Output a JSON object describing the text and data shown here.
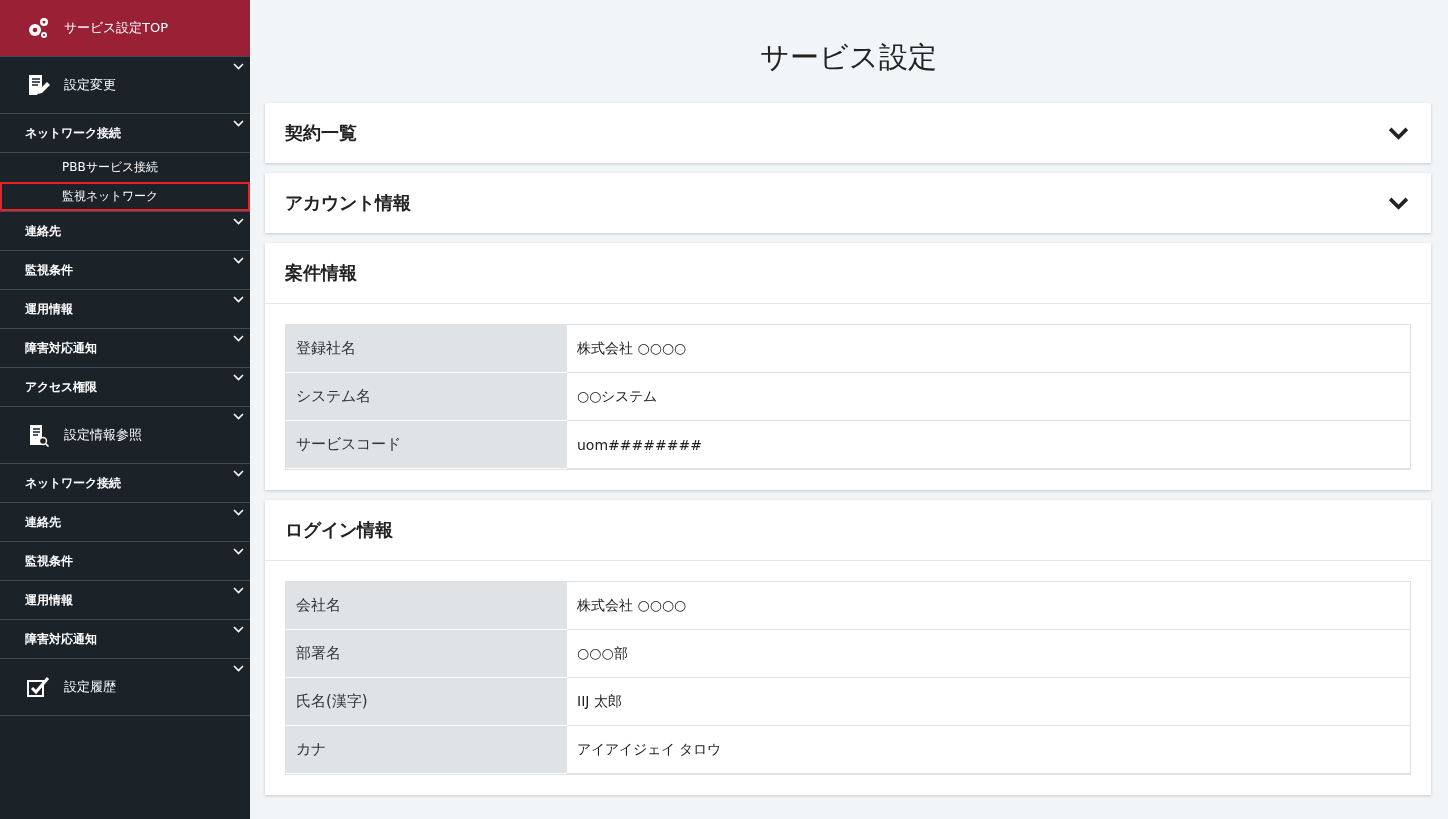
{
  "sidebar": {
    "items": [
      {
        "kind": "top",
        "label": "サービス設定TOP",
        "selected": true
      },
      {
        "kind": "group",
        "label": "設定変更"
      },
      {
        "kind": "section",
        "label": "ネットワーク接続"
      },
      {
        "kind": "sub",
        "label": "PBBサービス接続",
        "selected": false
      },
      {
        "kind": "sub",
        "label": "監視ネットワーク",
        "selected": true
      },
      {
        "kind": "section",
        "label": "連絡先"
      },
      {
        "kind": "section",
        "label": "監視条件"
      },
      {
        "kind": "section",
        "label": "運用情報"
      },
      {
        "kind": "section",
        "label": "障害対応通知"
      },
      {
        "kind": "section",
        "label": "アクセス権限"
      },
      {
        "kind": "group",
        "label": "設定情報参照"
      },
      {
        "kind": "section",
        "label": "ネットワーク接続"
      },
      {
        "kind": "section",
        "label": "連絡先"
      },
      {
        "kind": "section",
        "label": "監視条件"
      },
      {
        "kind": "section",
        "label": "運用情報"
      },
      {
        "kind": "section",
        "label": "障害対応通知"
      },
      {
        "kind": "group",
        "label": "設定履歴"
      }
    ]
  },
  "page_title": "サービス設定",
  "panels": [
    {
      "title": "契約一覧",
      "expanded": false
    },
    {
      "title": "アカウント情報",
      "expanded": false
    },
    {
      "title": "案件情報",
      "expanded": true,
      "rows": [
        {
          "label": "登録社名",
          "value": "株式会社 ○○○○"
        },
        {
          "label": "システム名",
          "value": "○○システム"
        },
        {
          "label": "サービスコード",
          "value": "uom########"
        }
      ]
    },
    {
      "title": "ログイン情報",
      "expanded": true,
      "rows": [
        {
          "label": "会社名",
          "value": "株式会社 ○○○○"
        },
        {
          "label": "部署名",
          "value": "○○○部"
        },
        {
          "label": "氏名(漢字)",
          "value": "IIJ 太郎"
        },
        {
          "label": "カナ",
          "value": "アイアイジェイ タロウ"
        }
      ]
    }
  ]
}
